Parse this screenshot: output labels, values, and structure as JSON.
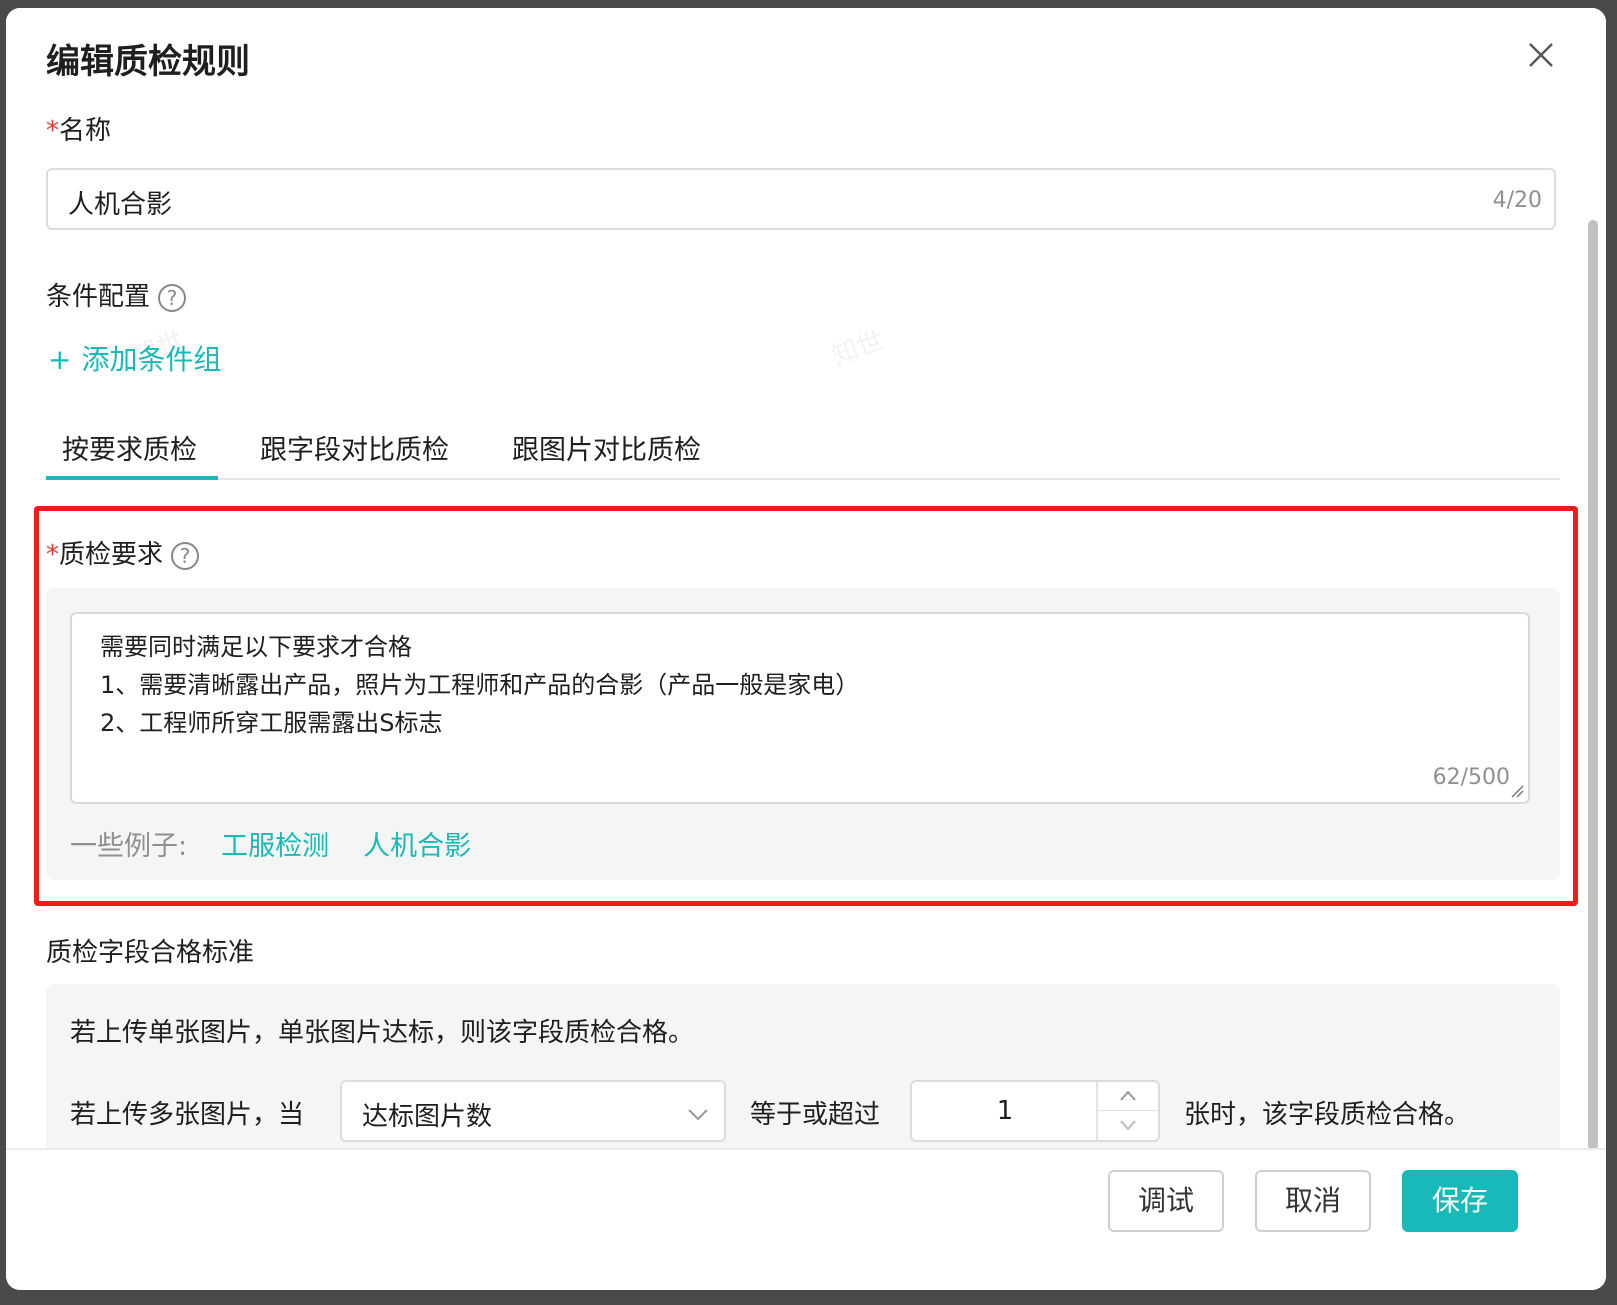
{
  "dialog": {
    "title": "编辑质检规则"
  },
  "name_field": {
    "required_mark": "*",
    "label": "名称",
    "value": "人机合影",
    "count": "4/20"
  },
  "condition": {
    "label": "条件配置",
    "help": "?",
    "add_group_plus": "+",
    "add_group_label": "添加条件组"
  },
  "tabs": [
    {
      "label": "按要求质检",
      "active": true
    },
    {
      "label": "跟字段对比质检",
      "active": false
    },
    {
      "label": "跟图片对比质检",
      "active": false
    }
  ],
  "requirement": {
    "required_mark": "*",
    "label": "质检要求",
    "help": "?",
    "lines": [
      "需要同时满足以下要求才合格",
      "1、需要清晰露出产品，照片为工程师和产品的合影（产品一般是家电）",
      "2、工程师所穿工服需露出S标志"
    ],
    "count": "62/500",
    "examples_label": "一些例子:",
    "examples": [
      "工服检测",
      "人机合影"
    ]
  },
  "standard": {
    "label": "质检字段合格标准",
    "line1": "若上传单张图片，单张图片达标，则该字段质检合格。",
    "line2_prefix": "若上传多张图片，当",
    "select_value": "达标图片数",
    "line2_middle": "等于或超过",
    "stepper_value": "1",
    "line2_suffix": "张时，该字段质检合格。"
  },
  "footer": {
    "debug": "调试",
    "cancel": "取消",
    "save": "保存"
  },
  "watermark_text": "知世",
  "colors": {
    "accent": "#1ab9b9",
    "highlight": "#f21b1b",
    "required": "#e53935"
  }
}
